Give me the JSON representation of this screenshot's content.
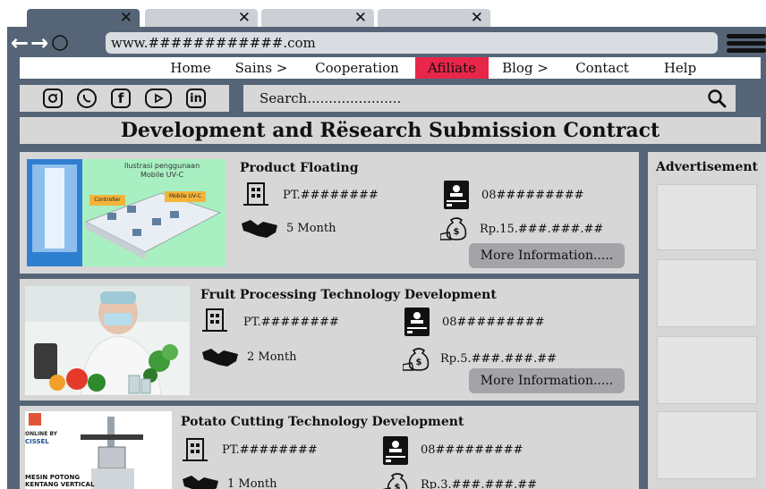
{
  "browser": {
    "tabs": [
      {
        "close": "✕",
        "active": true
      },
      {
        "close": "✕",
        "active": false
      },
      {
        "close": "✕",
        "active": false
      },
      {
        "close": "✕",
        "active": false
      }
    ],
    "url": "www.############.com"
  },
  "site_nav": {
    "items": [
      "Home",
      "Sains >",
      "Cooperation",
      "Afiliate",
      "Blog >",
      "Contact",
      "Help"
    ],
    "active": "Afiliate"
  },
  "social": [
    "instagram-icon",
    "whatsapp-icon",
    "facebook-icon",
    "youtube-icon",
    "linkedin-icon"
  ],
  "search": {
    "placeholder": "Search......................"
  },
  "page_title": "Development and Rësearch Submission Contract",
  "sidebar": {
    "title": "Advertisement"
  },
  "cards": [
    {
      "title": "Product Floating",
      "company": "PT.########",
      "phone": "08#########",
      "duration": "5 Month",
      "price": "Rp.15.###.###.##",
      "button": "More Information.....",
      "image_texts": [
        "Ilustrasi penggunaan",
        "Mobile UV-C",
        "Controller",
        "Mobile UV-C"
      ]
    },
    {
      "title": "Fruit Processing Technology Development",
      "company": "PT.########",
      "phone": "08#########",
      "duration": "2 Month",
      "price": "Rp.5.###.###.##",
      "button": "More Information....."
    },
    {
      "title": "Potato Cutting Technology Development",
      "company": "PT.########",
      "phone": "08#########",
      "duration": "1 Month",
      "price": "Rp.3.###.###.##",
      "image_texts": [
        "ONLINE BY",
        "CISSEL",
        "MESIN POTONG",
        "KENTANG VERTICAL"
      ]
    }
  ]
}
